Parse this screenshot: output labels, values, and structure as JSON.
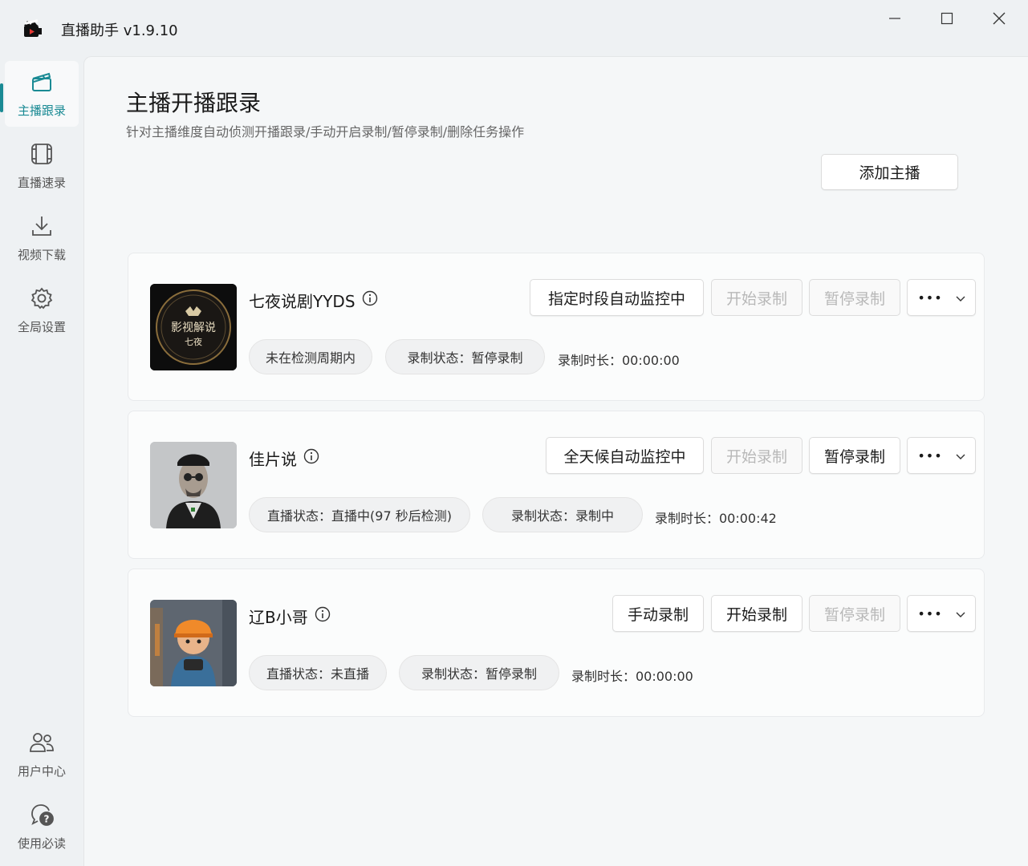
{
  "app": {
    "title": "直播助手 v1.9.10"
  },
  "sidebar": {
    "items": [
      {
        "label": "主播跟录",
        "icon": "clapperboard-icon",
        "active": true
      },
      {
        "label": "直播速录",
        "icon": "film-icon",
        "active": false
      },
      {
        "label": "视频下载",
        "icon": "download-icon",
        "active": false
      },
      {
        "label": "全局设置",
        "icon": "gear-icon",
        "active": false
      }
    ],
    "bottom_items": [
      {
        "label": "用户中心",
        "icon": "users-icon"
      },
      {
        "label": "使用必读",
        "icon": "help-chat-icon"
      }
    ]
  },
  "page": {
    "title": "主播开播跟录",
    "subtitle": "针对主播维度自动侦测开播跟录/手动开启录制/暂停录制/删除任务操作",
    "add_button": "添加主播"
  },
  "cards": [
    {
      "name": "七夜说剧YYDS",
      "avatar_text_1": "影视解说",
      "avatar_text_2": "七夜",
      "monitor_button": "指定时段自动监控中",
      "start_button": "开始录制",
      "pause_button": "暂停录制",
      "more_button": "•••",
      "status_pill": "未在检测周期内",
      "record_pill": "录制状态：暂停录制",
      "duration": "录制时长：00:00:00"
    },
    {
      "name": "佳片说",
      "monitor_button": "全天候自动监控中",
      "start_button": "开始录制",
      "pause_button": "暂停录制",
      "more_button": "•••",
      "status_pill": "直播状态：直播中(97 秒后检测)",
      "record_pill": "录制状态：录制中",
      "duration": "录制时长：00:00:42"
    },
    {
      "name": "辽B小哥",
      "monitor_button": "手动录制",
      "start_button": "开始录制",
      "pause_button": "暂停录制",
      "more_button": "•••",
      "status_pill": "直播状态：未直播",
      "record_pill": "录制状态：暂停录制",
      "duration": "录制时长：00:00:00"
    }
  ],
  "colors": {
    "accent": "#1a8a94",
    "disabled_text": "#b8b8b8"
  }
}
